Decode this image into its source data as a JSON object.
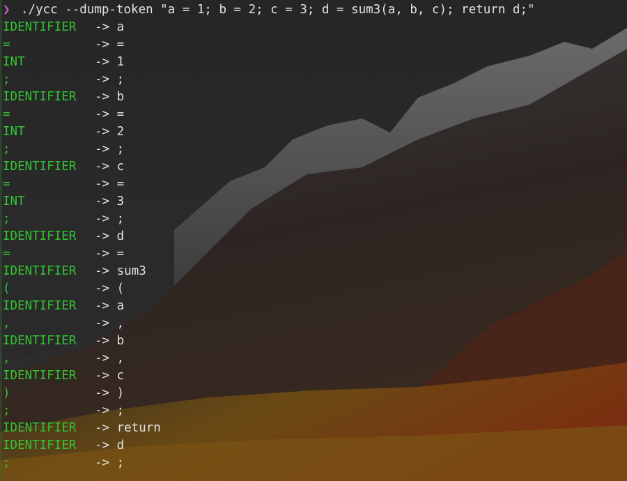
{
  "prompt": {
    "symbol": "❯",
    "command": "./ycc --dump-token \"a = 1; b = 2; c = 3; d = sum3(a, b, c); return d;\""
  },
  "arrow": "->",
  "tokens": [
    {
      "type": "IDENTIFIER",
      "value": "a"
    },
    {
      "type": "=",
      "value": "="
    },
    {
      "type": "INT",
      "value": "1"
    },
    {
      "type": ";",
      "value": ";"
    },
    {
      "type": "IDENTIFIER",
      "value": "b"
    },
    {
      "type": "=",
      "value": "="
    },
    {
      "type": "INT",
      "value": "2"
    },
    {
      "type": ";",
      "value": ";"
    },
    {
      "type": "IDENTIFIER",
      "value": "c"
    },
    {
      "type": "=",
      "value": "="
    },
    {
      "type": "INT",
      "value": "3"
    },
    {
      "type": ";",
      "value": ";"
    },
    {
      "type": "IDENTIFIER",
      "value": "d"
    },
    {
      "type": "=",
      "value": "="
    },
    {
      "type": "IDENTIFIER",
      "value": "sum3"
    },
    {
      "type": "(",
      "value": "("
    },
    {
      "type": "IDENTIFIER",
      "value": "a"
    },
    {
      "type": ",",
      "value": ","
    },
    {
      "type": "IDENTIFIER",
      "value": "b"
    },
    {
      "type": ",",
      "value": ","
    },
    {
      "type": "IDENTIFIER",
      "value": "c"
    },
    {
      "type": ")",
      "value": ")"
    },
    {
      "type": ";",
      "value": ";"
    },
    {
      "type": "IDENTIFIER",
      "value": "return"
    },
    {
      "type": "IDENTIFIER",
      "value": "d"
    },
    {
      "type": ";",
      "value": ";"
    }
  ],
  "colors": {
    "token_type": "#33c533",
    "text": "#e2e2e2",
    "prompt_symbol": "#c061cb",
    "background": "#232323"
  }
}
